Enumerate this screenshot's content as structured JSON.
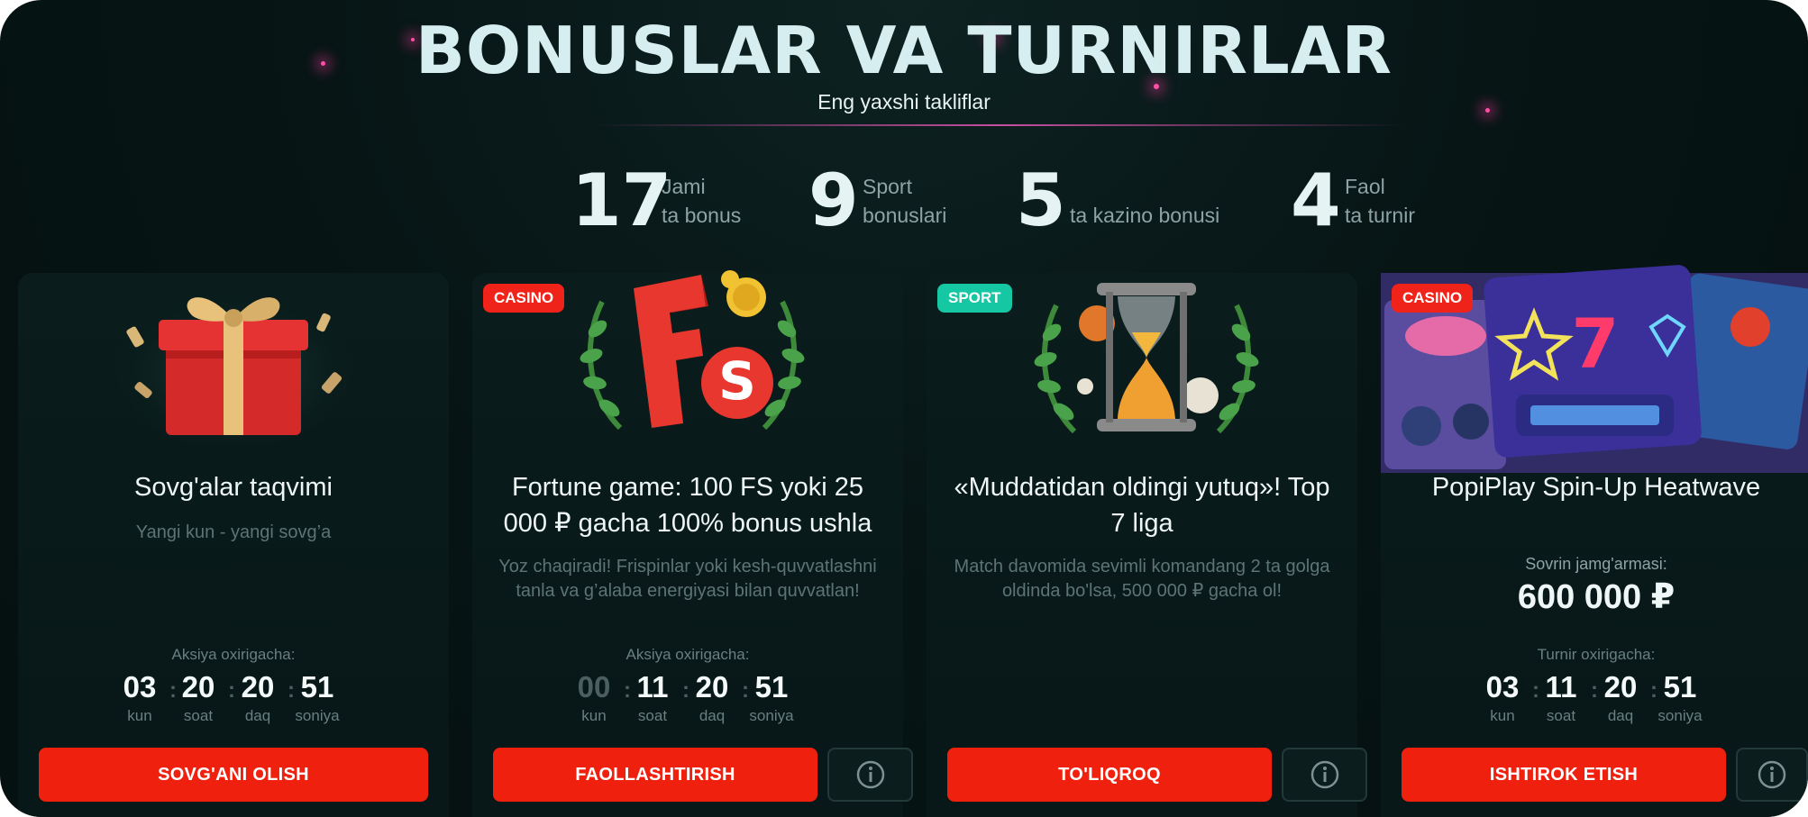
{
  "header": {
    "title": "BONUSLAR VA TURNIRLAR",
    "subtitle": "Eng yaxshi takliflar"
  },
  "stats": [
    {
      "value": "17",
      "line1": "Jami",
      "line2": "ta bonus"
    },
    {
      "value": "9",
      "line1": "Sport",
      "line2": "bonuslari"
    },
    {
      "value": "5",
      "line1": "",
      "line2": "ta kazino bonusi"
    },
    {
      "value": "4",
      "line1": "Faol",
      "line2": "ta turnir"
    }
  ],
  "cards": [
    {
      "badge": "",
      "image_icon": "gift-box",
      "title": "Sovg'alar taqvimi",
      "description": "Yangi kun - yangi sovg’a",
      "timer_label": "Aksiya oxirigacha:",
      "timer": {
        "days": "03",
        "hours": "20",
        "minutes": "20",
        "seconds": "51"
      },
      "units": {
        "days": "kun",
        "hours": "soat",
        "minutes": "daq",
        "seconds": "soniya"
      },
      "button": "SOVG'ANI OLISH"
    },
    {
      "badge": "CASINO",
      "image_icon": "free-spins-laurel",
      "title": "Fortune game: 100 FS yoki 25 000 ₽ gacha 100% bonus ushla",
      "description": "Yoz chaqiradi! Frispinlar yoki kesh-quvvatlashni tanla va g’alaba energiyasi bilan quvvatlan!",
      "timer_label": "Aksiya oxirigacha:",
      "timer": {
        "days": "00",
        "hours": "11",
        "minutes": "20",
        "seconds": "51"
      },
      "units": {
        "days": "kun",
        "hours": "soat",
        "minutes": "daq",
        "seconds": "soniya"
      },
      "button": "FAOLLASHTIRISH"
    },
    {
      "badge": "SPORT",
      "image_icon": "hourglass-laurel",
      "title": "«Muddatidan oldingi yutuq»! Top 7 liga",
      "description": "Match davomida sevimli komandang 2 ta golga oldinda bo'lsa, 500 000 ₽ gacha ol!",
      "button": "TO'LIQROQ"
    },
    {
      "badge": "CASINO",
      "image_icon": "slot-games-collage",
      "title": "PopiPlay Spin-Up Heatwave",
      "prize_label": "Sovrin jamg'armasi:",
      "prize_value": "600 000 ₽",
      "timer_label": "Turnir oxirigacha:",
      "timer": {
        "days": "03",
        "hours": "11",
        "minutes": "20",
        "seconds": "51"
      },
      "units": {
        "days": "kun",
        "hours": "soat",
        "minutes": "daq",
        "seconds": "soniya"
      },
      "button": "ISHTIROK ETISH"
    }
  ],
  "colors": {
    "background": "#071515",
    "card": "#0a1c1c",
    "button": "#f0200e",
    "casino_badge": "#f0231a",
    "sport_badge": "#16c7a3"
  }
}
